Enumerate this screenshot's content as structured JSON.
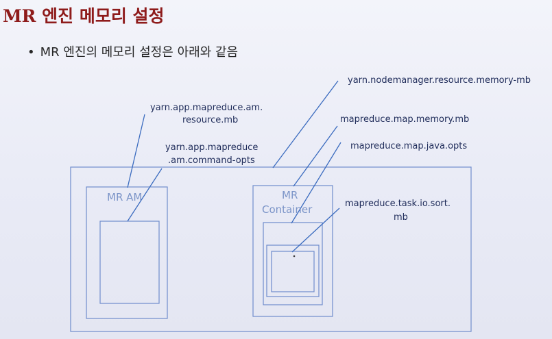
{
  "slide": {
    "title": "MR 엔진 메모리 설정",
    "bullet": "MR 엔진의 메모리 설정은 아래와 같음"
  },
  "diagram": {
    "labels": {
      "nodemanager": "yarn.nodemanager.resource.memory-mb",
      "am_resource_1": "yarn.app.mapreduce.am.",
      "am_resource_2": "resource.mb",
      "am_opts_1": "yarn.app.mapreduce",
      "am_opts_2": ".am.command-opts",
      "map_memory": "mapreduce.map.memory.mb",
      "map_java_opts": "mapreduce.map.java.opts",
      "sort_mb_1": "mapreduce.task.io.sort.",
      "sort_mb_2": "mb"
    },
    "boxes": {
      "mr_am": "MR AM",
      "mr_container_1": "MR",
      "mr_container_2": "Container"
    }
  }
}
